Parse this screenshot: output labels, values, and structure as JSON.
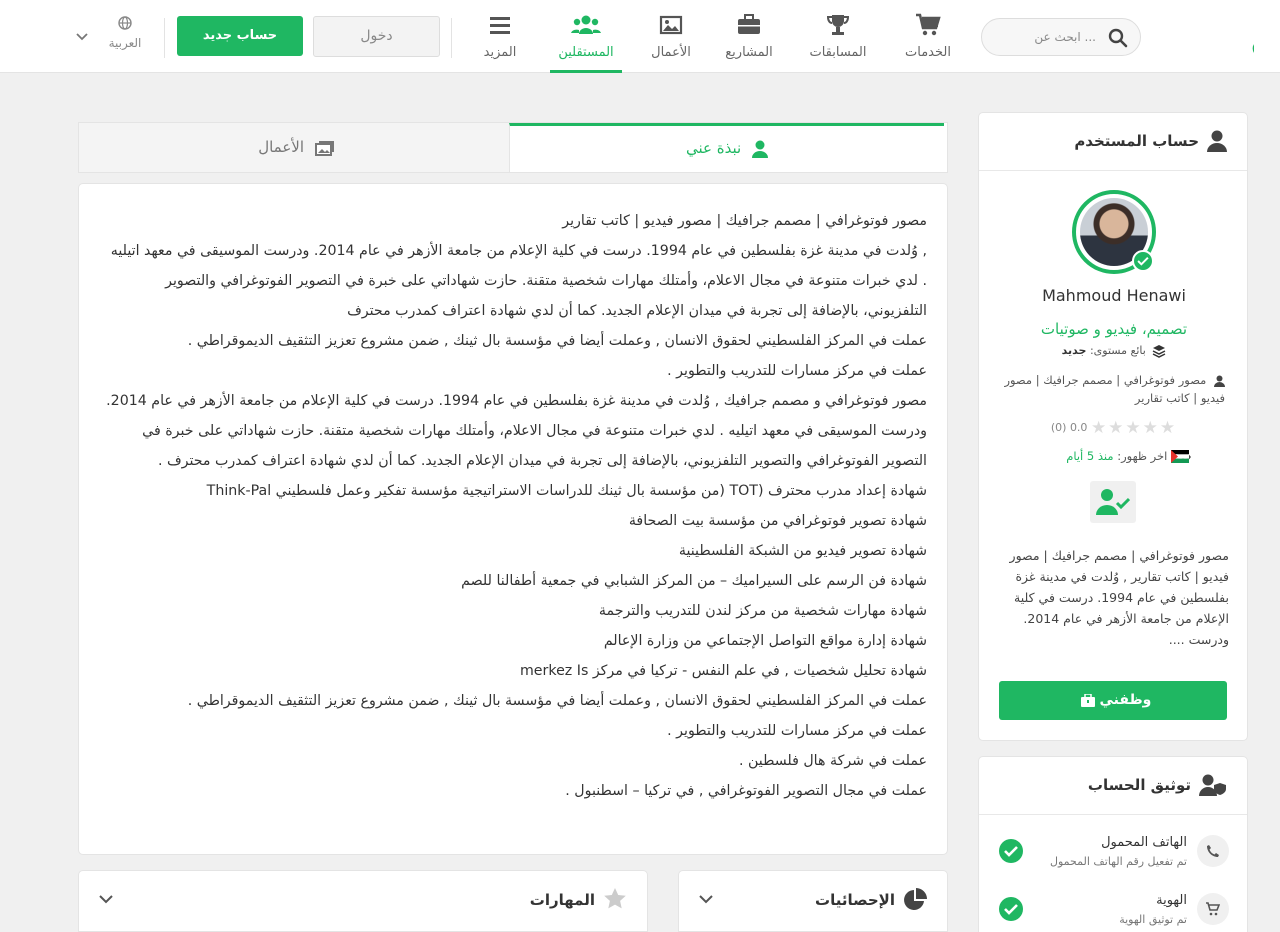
{
  "header": {
    "logo": "كفيل",
    "search_placeholder": "ابحث عن ...",
    "nav": [
      {
        "label": "الخدمات",
        "icon": "cart-icon"
      },
      {
        "label": "المسابقات",
        "icon": "trophy-icon"
      },
      {
        "label": "المشاريع",
        "icon": "briefcase-icon"
      },
      {
        "label": "الأعمال",
        "icon": "image-icon"
      },
      {
        "label": "المستقلين",
        "icon": "users-icon"
      },
      {
        "label": "المزيد",
        "icon": "menu-icon"
      }
    ],
    "login_label": "دخول",
    "signup_label": "حساب جديد",
    "language_label": "العربية"
  },
  "tabs": {
    "about_label": "نبذة عني",
    "works_label": "الأعمال"
  },
  "bio": {
    "lines": [
      "مصور فوتوغرافي | مصمم جرافيك | مصور فيديو | كاتب تقارير",
      ", وُلدت في مدينة غزة بفلسطين في عام 1994. درست في كلية الإعلام من جامعة الأزهر في عام 2014. ودرست الموسيقى في معهد اتيليه . لدي خبرات متنوعة في مجال الاعلام، وأمتلك مهارات شخصية متقنة. حازت شهاداتي على خبرة في التصوير الفوتوغرافي والتصوير التلفزيوني، بالإضافة إلى تجربة في ميدان الإعلام الجديد. كما أن لدي شهادة اعتراف كمدرب محترف",
      "عملت في المركز الفلسطيني لحقوق الانسان , وعملت أيضا في مؤسسة بال ثينك , ضمن مشروع تعزيز التثقيف الديموقراطي .",
      "عملت في مركز مسارات للتدريب والتطوير .",
      "مصور فوتوغرافي و مصمم جرافيك , وُلدت في مدينة غزة بفلسطين في عام 1994. درست في كلية الإعلام من جامعة الأزهر في عام 2014. ودرست الموسيقى في معهد اتيليه . لدي خبرات متنوعة في مجال الاعلام، وأمتلك مهارات شخصية متقنة. حازت شهاداتي على خبرة في التصوير الفوتوغرافي والتصوير التلفزيوني، بالإضافة إلى تجربة في ميدان الإعلام الجديد. كما أن لدي شهادة اعتراف كمدرب محترف .",
      "شهادة إعداد مدرب محترف (TOT (من مؤسسة بال ثينك للدراسات الاستراتيجية مؤسسة تفكير وعمل فلسطيني Think-Pal",
      "شهادة تصوير فوتوغرافي من مؤسسة بيت الصحافة",
      "شهادة تصوير فيديو من الشبكة الفلسطينية",
      "شهادة فن الرسم على السيراميك – من المركز الشبابي في جمعية أطفالنا للصم",
      "شهادة مهارات شخصية من مركز لندن للتدريب والترجمة",
      "شهادة إدارة مواقع التواصل الإجتماعي من وزارة الإعالم",
      "شهادة تحليل شخصيات , في علم النفس - تركيا في مركز merkez Is",
      "عملت في المركز الفلسطيني لحقوق الانسان , وعملت أيضا في مؤسسة بال ثينك , ضمن مشروع تعزيز التثقيف الديموقراطي .",
      "عملت في مركز مسارات للتدريب والتطوير .",
      "عملت في شركة هال فلسطين .",
      "عملت في مجال التصوير الفوتوغرافي , في تركيا – اسطنبول ."
    ]
  },
  "panels": {
    "skills_title": "المهارات",
    "stats_title": "الإحصائيات"
  },
  "profile": {
    "card_title": "حساب المستخدم",
    "name": "Mahmoud Henawi",
    "specialty": "تصميم، فيديو و صوتيات",
    "level_label": "بائع مستوى:",
    "level_value": "جديد",
    "headline": "مصور فوتوغرافي | مصمم جرافيك | مصور فيديو | كاتب تقارير",
    "rating_value": "0.0",
    "rating_count": "(0)",
    "rating_stars": 0,
    "last_seen_label": "اخر ظهور:",
    "last_seen_value": "منذ 5 أيام",
    "about_excerpt": "مصور فوتوغرافي | مصمم جرافيك | مصور فيديو | كاتب تقارير , وُلدت في مدينة غزة بفلسطين في عام 1994. درست في كلية الإعلام من جامعة الأزهر في عام 2014. ودرست ....",
    "hire_label": "وظفني"
  },
  "verification": {
    "title": "توثيق الحساب",
    "items": [
      {
        "title": "الهاتف المحمول",
        "sub": "تم تفعيل رقم الهاتف المحمول",
        "icon": "phone-icon"
      },
      {
        "title": "الهوية",
        "sub": "تم توثيق الهوية",
        "icon": "cart-icon"
      }
    ]
  },
  "colors": {
    "accent": "#1fb762"
  }
}
